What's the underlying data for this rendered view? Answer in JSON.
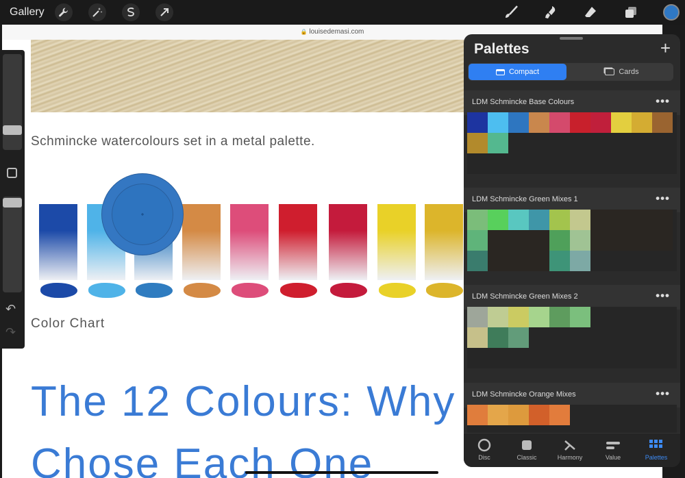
{
  "toolbar": {
    "gallery_label": "Gallery",
    "left_tools": [
      "wrench-icon",
      "magic-wand-icon",
      "selection-icon",
      "transform-arrow-icon"
    ],
    "right_tools": [
      "brush-icon",
      "smudge-icon",
      "eraser-icon",
      "layers-icon"
    ],
    "current_color": "#2f78c4"
  },
  "canvas": {
    "url": "louisedemasi.com",
    "caption": "Schmincke watercolours set in a metal palette.",
    "chart_label": "Color Chart",
    "heading_line1": "The 12 Colours: Why",
    "heading_line2": "Chose Each One",
    "swatches": [
      "#1c4aa8",
      "#4fb3e8",
      "#2f7cc0",
      "#d48a45",
      "#dd4d7a",
      "#cf1e2e",
      "#c41b3c",
      "#e9d128",
      "#dcb52b"
    ],
    "loupe_color": "#2e74bf"
  },
  "sidebar": {
    "modify_icon": "square-modify-icon",
    "undo_icon": "undo-icon",
    "redo_icon": "redo-icon",
    "brush_size_level": 0.25,
    "opacity_level": 0.94
  },
  "panel": {
    "title": "Palettes",
    "add_icon": "plus-icon",
    "seg_compact": "Compact",
    "seg_cards": "Cards",
    "palettes": [
      {
        "name": "LDM Schmincke Base Colours",
        "colors": [
          "#1d34a0",
          "#4dbef0",
          "#2e76c0",
          "#c9874d",
          "#d44a6c",
          "#c8202c",
          "#c01f3b",
          "#e3cf3f",
          "#d4ac32",
          "#9a6430",
          "#b28a2c",
          "#54b88f"
        ]
      },
      {
        "name": "LDM Schmincke Green Mixes 1",
        "colors": [
          "#7bbd7a",
          "#58d05c",
          "#59c7c0",
          "#3f96a8",
          "#a3c44d",
          "#c3c88e",
          "",
          "",
          "",
          "",
          "#5fb47a",
          "",
          "",
          "",
          "#4fa05a",
          "#a0c394",
          "",
          "",
          "",
          "",
          "#3a7c6d",
          "",
          "",
          "",
          "#3e9478",
          "#7da9a5"
        ]
      },
      {
        "name": "LDM Schmincke Green Mixes 2",
        "colors": [
          "#9ea69a",
          "#bfcc93",
          "#cbcb62",
          "#a6d48d",
          "#5e9c5e",
          "#7bbf7d",
          "",
          "",
          "",
          "",
          "#c6c08a",
          "#3f7c5a",
          "#629c7a"
        ]
      },
      {
        "name": "LDM Schmincke Orange Mixes",
        "colors": [
          "#e07d3c",
          "#e4a64a",
          "#dd9a3d",
          "#d2602a",
          "#e27c3c"
        ]
      }
    ],
    "tabs": [
      {
        "label": "Disc",
        "icon": "disc-icon",
        "active": false
      },
      {
        "label": "Classic",
        "icon": "classic-square-icon",
        "active": false
      },
      {
        "label": "Harmony",
        "icon": "harmony-icon",
        "active": false
      },
      {
        "label": "Value",
        "icon": "value-sliders-icon",
        "active": false
      },
      {
        "label": "Palettes",
        "icon": "palettes-grid-icon",
        "active": true
      }
    ]
  }
}
